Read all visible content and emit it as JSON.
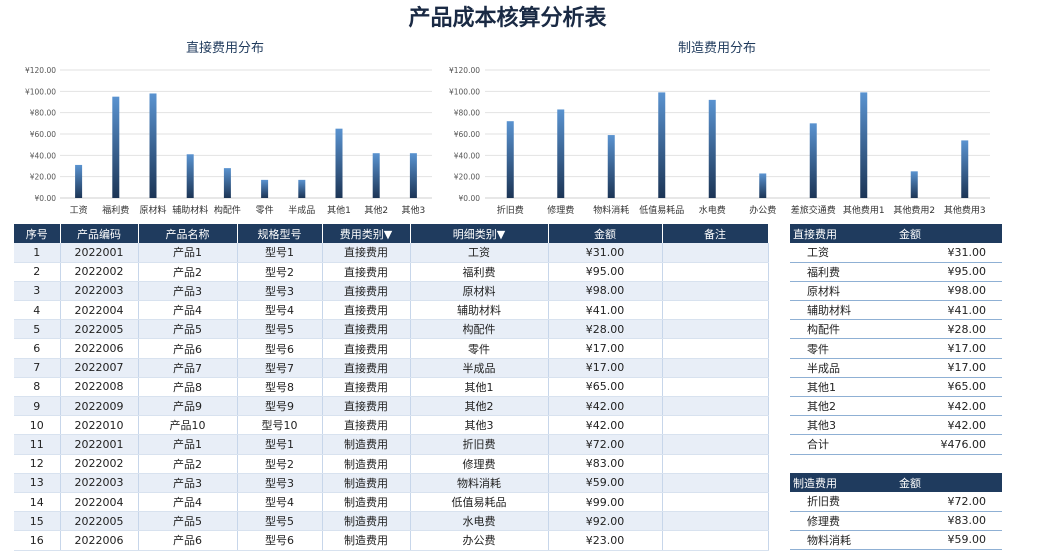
{
  "title": "产品成本核算分析表",
  "chart_data": [
    {
      "type": "bar",
      "title": "直接费用分布",
      "categories": [
        "工资",
        "福利费",
        "原材料",
        "辅助材料",
        "构配件",
        "零件",
        "半成品",
        "其他1",
        "其他2",
        "其他3"
      ],
      "values": [
        31,
        95,
        98,
        41,
        28,
        17,
        17,
        65,
        42,
        42
      ],
      "ylim": [
        0,
        120
      ],
      "yticks": [
        "¥0.00",
        "¥20.00",
        "¥40.00",
        "¥60.00",
        "¥80.00",
        "¥100.00",
        "¥120.00"
      ],
      "grid": true
    },
    {
      "type": "bar",
      "title": "制造费用分布",
      "categories": [
        "折旧费",
        "修理费",
        "物料消耗",
        "低值易耗品",
        "水电费",
        "办公费",
        "差旅交通费",
        "其他费用1",
        "其他费用2",
        "其他费用3"
      ],
      "values": [
        72,
        83,
        59,
        99,
        92,
        23,
        70,
        99,
        25,
        54
      ],
      "ylim": [
        0,
        120
      ],
      "yticks": [
        "¥0.00",
        "¥20.00",
        "¥40.00",
        "¥60.00",
        "¥80.00",
        "¥100.00",
        "¥120.00"
      ],
      "grid": true
    }
  ],
  "table": {
    "headers": [
      "序号",
      "产品编码",
      "产品名称",
      "规格型号",
      "费用类别▼",
      "明细类别▼",
      "金额",
      "备注"
    ],
    "rows": [
      [
        "1",
        "2022001",
        "产品1",
        "型号1",
        "直接费用",
        "工资",
        "¥31.00",
        ""
      ],
      [
        "2",
        "2022002",
        "产品2",
        "型号2",
        "直接费用",
        "福利费",
        "¥95.00",
        ""
      ],
      [
        "3",
        "2022003",
        "产品3",
        "型号3",
        "直接费用",
        "原材料",
        "¥98.00",
        ""
      ],
      [
        "4",
        "2022004",
        "产品4",
        "型号4",
        "直接费用",
        "辅助材料",
        "¥41.00",
        ""
      ],
      [
        "5",
        "2022005",
        "产品5",
        "型号5",
        "直接费用",
        "构配件",
        "¥28.00",
        ""
      ],
      [
        "6",
        "2022006",
        "产品6",
        "型号6",
        "直接费用",
        "零件",
        "¥17.00",
        ""
      ],
      [
        "7",
        "2022007",
        "产品7",
        "型号7",
        "直接费用",
        "半成品",
        "¥17.00",
        ""
      ],
      [
        "8",
        "2022008",
        "产品8",
        "型号8",
        "直接费用",
        "其他1",
        "¥65.00",
        ""
      ],
      [
        "9",
        "2022009",
        "产品9",
        "型号9",
        "直接费用",
        "其他2",
        "¥42.00",
        ""
      ],
      [
        "10",
        "2022010",
        "产品10",
        "型号10",
        "直接费用",
        "其他3",
        "¥42.00",
        ""
      ],
      [
        "11",
        "2022001",
        "产品1",
        "型号1",
        "制造费用",
        "折旧费",
        "¥72.00",
        ""
      ],
      [
        "12",
        "2022002",
        "产品2",
        "型号2",
        "制造费用",
        "修理费",
        "¥83.00",
        ""
      ],
      [
        "13",
        "2022003",
        "产品3",
        "型号3",
        "制造费用",
        "物料消耗",
        "¥59.00",
        ""
      ],
      [
        "14",
        "2022004",
        "产品4",
        "型号4",
        "制造费用",
        "低值易耗品",
        "¥99.00",
        ""
      ],
      [
        "15",
        "2022005",
        "产品5",
        "型号5",
        "制造费用",
        "水电费",
        "¥92.00",
        ""
      ],
      [
        "16",
        "2022006",
        "产品6",
        "型号6",
        "制造费用",
        "办公费",
        "¥23.00",
        ""
      ]
    ]
  },
  "direct_summary": {
    "headers": [
      "直接费用",
      "金额"
    ],
    "rows": [
      [
        "工资",
        "¥31.00"
      ],
      [
        "福利费",
        "¥95.00"
      ],
      [
        "原材料",
        "¥98.00"
      ],
      [
        "辅助材料",
        "¥41.00"
      ],
      [
        "构配件",
        "¥28.00"
      ],
      [
        "零件",
        "¥17.00"
      ],
      [
        "半成品",
        "¥17.00"
      ],
      [
        "其他1",
        "¥65.00"
      ],
      [
        "其他2",
        "¥42.00"
      ],
      [
        "其他3",
        "¥42.00"
      ],
      [
        "合计",
        "¥476.00"
      ]
    ]
  },
  "mfg_summary": {
    "headers": [
      "制造费用",
      "金额"
    ],
    "rows": [
      [
        "折旧费",
        "¥72.00"
      ],
      [
        "修理费",
        "¥83.00"
      ],
      [
        "物料消耗",
        "¥59.00"
      ]
    ]
  }
}
